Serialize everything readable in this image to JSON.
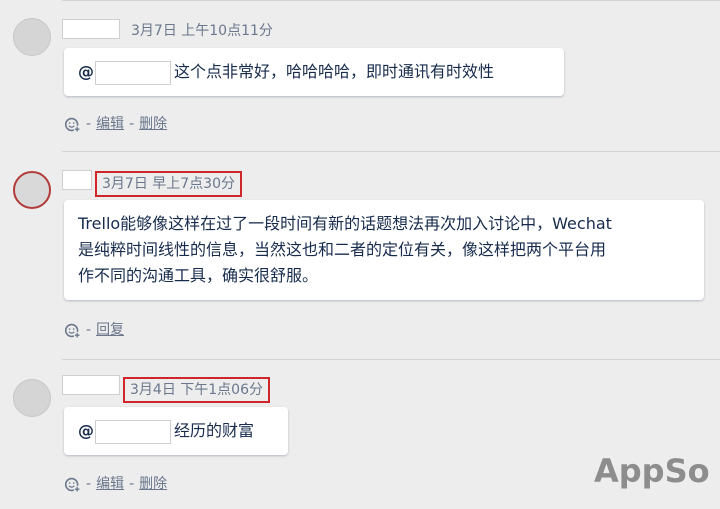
{
  "comments": [
    {
      "time": "3月7日 上午10点11分",
      "mention_prefix": "@",
      "text": "这个点非常好，哈哈哈哈，即时通讯有时效性",
      "actions": [
        "编辑",
        "删除"
      ]
    },
    {
      "time": "3月7日 早上7点30分",
      "text_lines": [
        "Trello能够像这样在过了一段时间有新的话题想法再次加入讨论中，Wechat",
        "是纯粹时间线性的信息，当然这也和二者的定位有关，像这样把两个平台用",
        "作不同的沟通工具，确实很舒服。"
      ],
      "actions": [
        "回复"
      ]
    },
    {
      "time": "3月4日 下午1点06分",
      "mention_prefix": "@",
      "text": "经历的财富",
      "actions": [
        "编辑",
        "删除"
      ]
    }
  ],
  "action_separator": "-",
  "watermark": "AppSo",
  "colors": {
    "highlight": "#d0252b",
    "meta_text": "#6b778c",
    "body_text": "#172b4d"
  },
  "icons": {
    "reaction": "add-reaction-icon"
  }
}
